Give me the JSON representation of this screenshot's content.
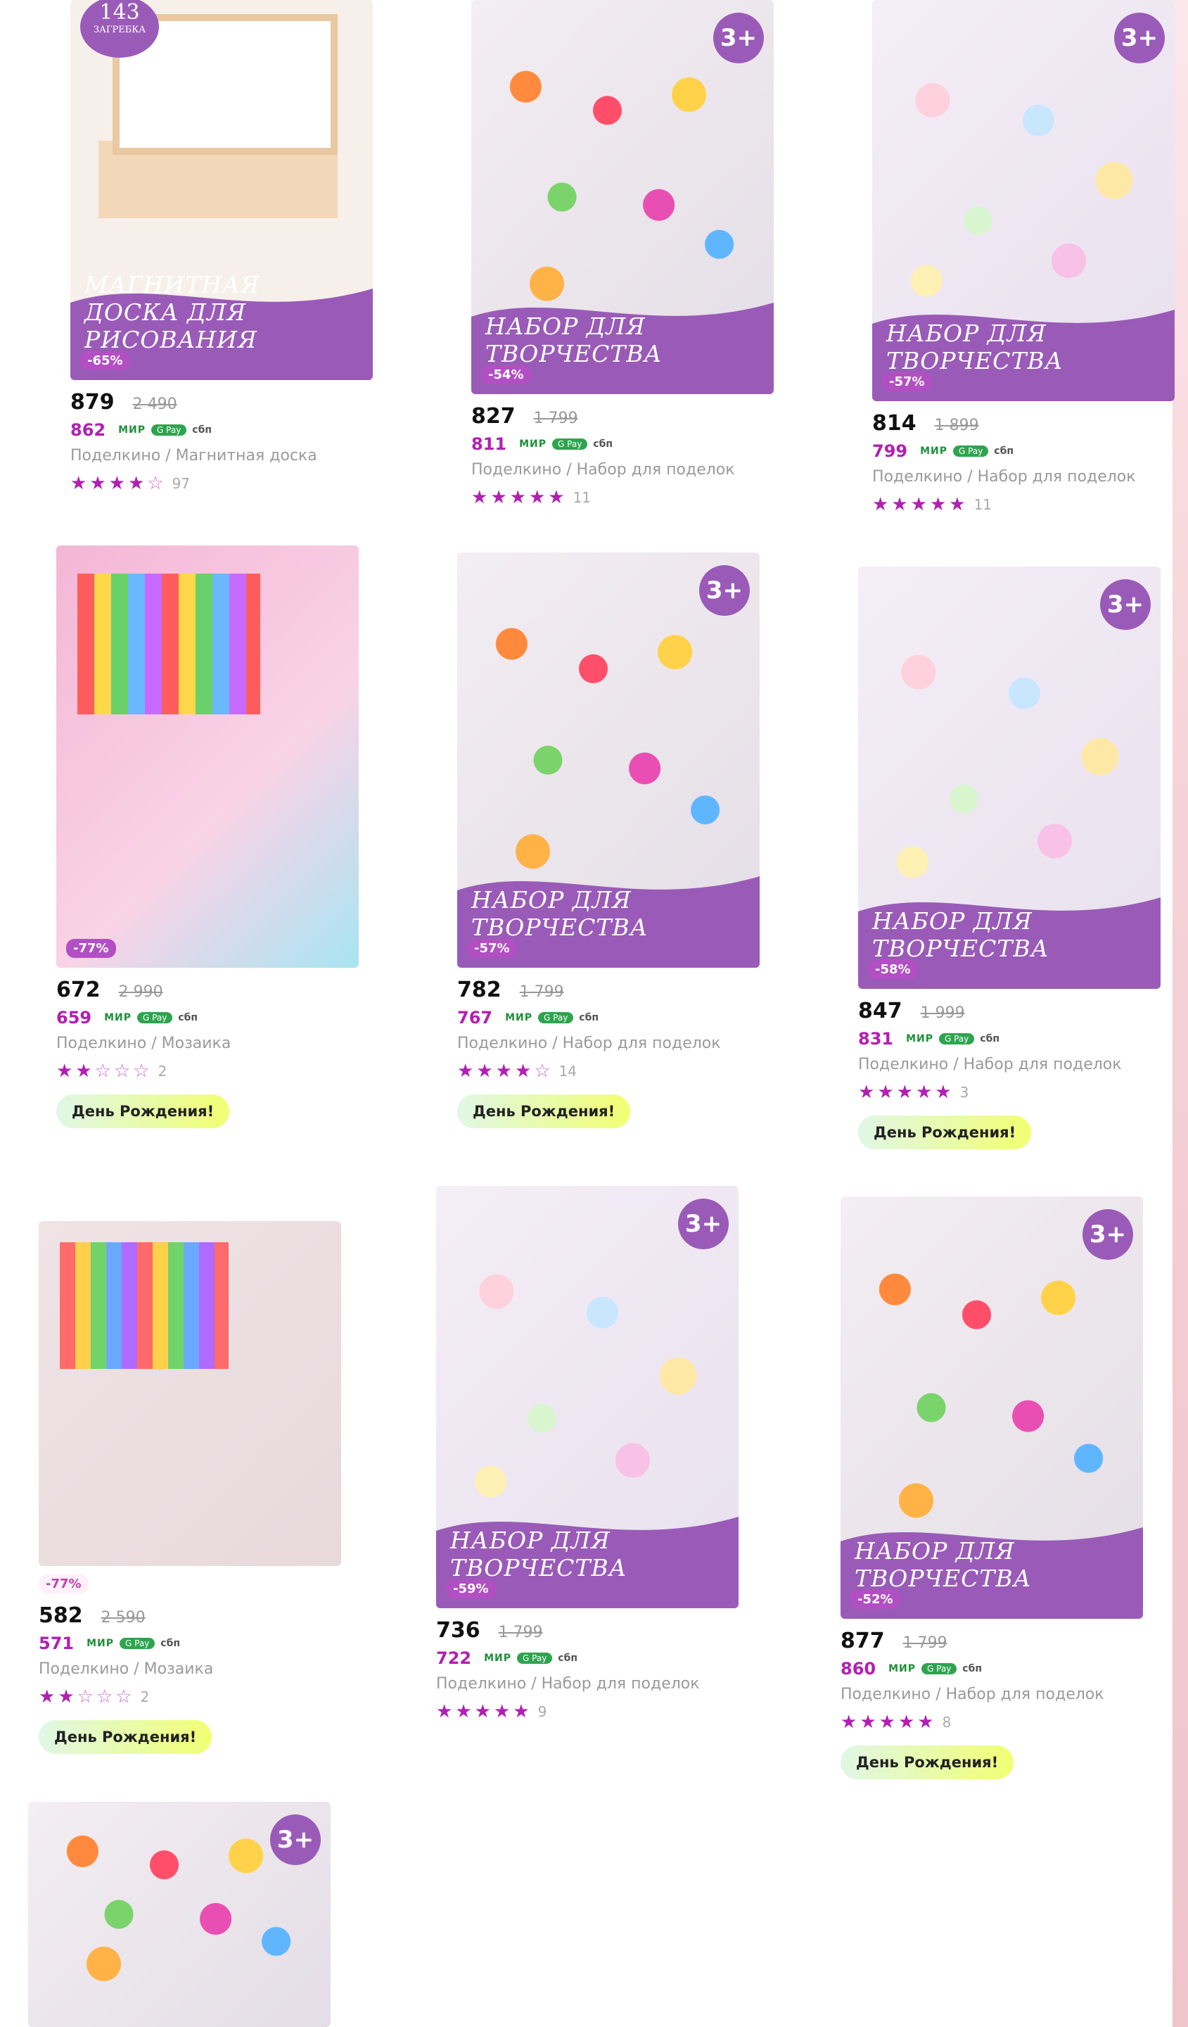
{
  "products": [
    {
      "title": "Магнитная доска для рисования",
      "count": "143",
      "count_unit": "ЗАГРЕБКА",
      "age": "",
      "discount": "-65%",
      "price": "879",
      "old_price": "2 490",
      "card_price": "862",
      "category": "Поделкино / Магнитная доска",
      "rating": 4,
      "reviews": "97",
      "bday": "",
      "image": "board"
    },
    {
      "title": "Набор для творчества",
      "age": "3+",
      "discount": "-54%",
      "price": "827",
      "old_price": "1 799",
      "card_price": "811",
      "category": "Поделкино / Набор для поделок",
      "rating": 5,
      "reviews": "11",
      "bday": "",
      "image": "bright"
    },
    {
      "title": "Набор для творчества",
      "age": "3+",
      "discount": "-57%",
      "price": "814",
      "old_price": "1 899",
      "card_price": "799",
      "category": "Поделкино / Набор для поделок",
      "rating": 5,
      "reviews": "11",
      "bday": "",
      "image": "pastel"
    },
    {
      "title": "",
      "age": "",
      "discount": "-77%",
      "price": "672",
      "old_price": "2 990",
      "card_price": "659",
      "category": "Поделкино / Мозаика",
      "rating": 2,
      "reviews": "2",
      "bday": "День Рождения!",
      "image": "mosaic"
    },
    {
      "title": "Набор для творчества",
      "age": "3+",
      "discount": "-57%",
      "price": "782",
      "old_price": "1 799",
      "card_price": "767",
      "category": "Поделкино / Набор для поделок",
      "rating": 4,
      "reviews": "14",
      "bday": "День Рождения!",
      "image": "bright"
    },
    {
      "title": "Набор для творчества",
      "age": "3+",
      "discount": "-58%",
      "price": "847",
      "old_price": "1 999",
      "card_price": "831",
      "category": "Поделкино / Набор для поделок",
      "rating": 5,
      "reviews": "3",
      "bday": "День Рождения!",
      "image": "pastel"
    },
    {
      "title": "",
      "age": "",
      "discount": "-77%",
      "price": "582",
      "old_price": "2 590",
      "card_price": "571",
      "category": "Поделкино / Мозаика",
      "rating": 2,
      "reviews": "2",
      "bday": "День Рождения!",
      "image": "mosaic2"
    },
    {
      "title": "Набор для творчества",
      "age": "3+",
      "discount": "-59%",
      "price": "736",
      "old_price": "1 799",
      "card_price": "722",
      "category": "Поделкино / Набор для поделок",
      "rating": 5,
      "reviews": "9",
      "bday": "",
      "image": "pastel"
    },
    {
      "title": "Набор для творчества",
      "age": "3+",
      "discount": "-52%",
      "price": "877",
      "old_price": "1 799",
      "card_price": "860",
      "category": "Поделкино / Набор для поделок",
      "rating": 5,
      "reviews": "8",
      "bday": "День Рождения!",
      "image": "bright"
    },
    {
      "title": "",
      "age": "3+",
      "discount": "",
      "price": "",
      "old_price": "",
      "card_price": "",
      "category": "",
      "rating": 0,
      "reviews": "",
      "bday": "",
      "image": "bright"
    }
  ],
  "payment": {
    "mir": "МИР",
    "gpay": "G Pay",
    "sbp": "сбп"
  },
  "colors": {
    "accent": "#b21fb3",
    "banner": "#9a5bb8",
    "discount": "#b24fc3"
  }
}
